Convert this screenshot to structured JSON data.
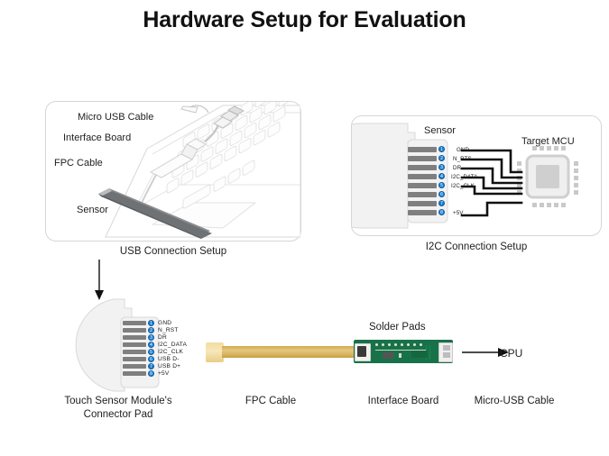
{
  "title": "Hardware Setup for Evaluation",
  "panels": {
    "usb": {
      "caption": "USB Connection Setup",
      "labels": {
        "micro_usb_cable": "Micro USB Cable",
        "interface_board": "Interface Board",
        "fpc_cable": "FPC Cable",
        "sensor": "Sensor"
      }
    },
    "i2c": {
      "caption": "I2C Connection Setup",
      "labels": {
        "sensor": "Sensor",
        "target_mcu": "Target MCU"
      },
      "pins": [
        {
          "num": "1",
          "label": "GND"
        },
        {
          "num": "2",
          "label": "N_RTS"
        },
        {
          "num": "3",
          "label": "DR"
        },
        {
          "num": "4",
          "label": "I2C_DATA"
        },
        {
          "num": "5",
          "label": "I2C_CLK"
        },
        {
          "num": "6",
          "label": ""
        },
        {
          "num": "7",
          "label": ""
        },
        {
          "num": "8",
          "label": "+5V"
        }
      ]
    }
  },
  "bottom": {
    "pins": [
      {
        "num": "1",
        "label": "GND"
      },
      {
        "num": "2",
        "label": "N_RST"
      },
      {
        "num": "3",
        "label": "DR"
      },
      {
        "num": "4",
        "label": "I2C_DATA"
      },
      {
        "num": "5",
        "label": "I2C_CLK"
      },
      {
        "num": "6",
        "label": "USB D-"
      },
      {
        "num": "7",
        "label": "USB D+"
      },
      {
        "num": "8",
        "label": "+5V"
      }
    ],
    "captions": {
      "connector_pad": "Touch Sensor Module's",
      "connector_pad2": "Connector Pad",
      "fpc_cable": "FPC Cable",
      "interface_board": "Interface Board",
      "micro_usb_cable": "Micro-USB Cable"
    },
    "solder_pads": "Solder Pads",
    "cpu": "CPU"
  },
  "colors": {
    "accent_blue": "#1b7fd4",
    "pcb_green": "#17724a",
    "fpc_tan": "#d8b561",
    "panel_border": "#d6d6d6",
    "text": "#1a1a1a"
  }
}
